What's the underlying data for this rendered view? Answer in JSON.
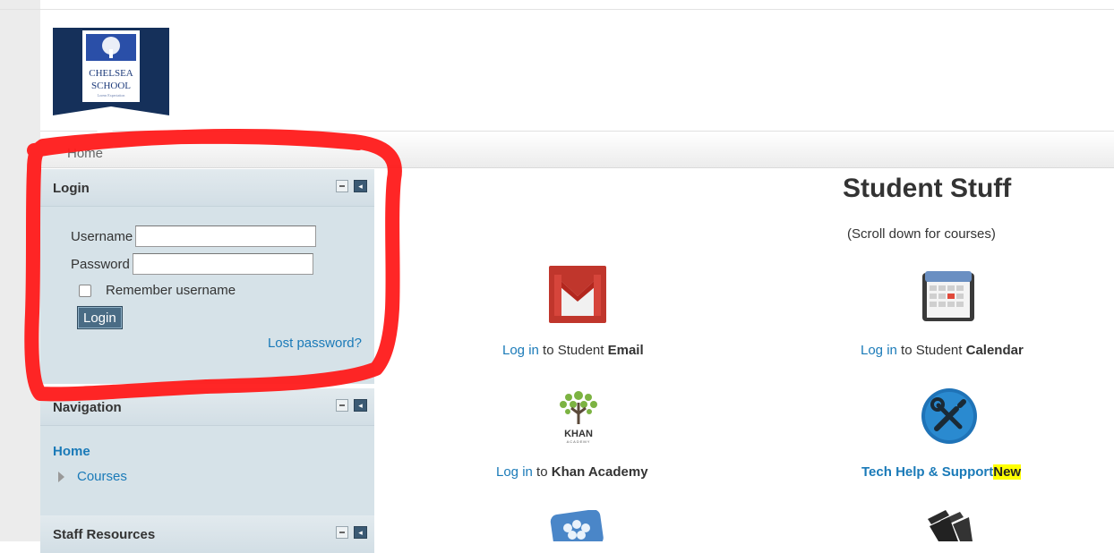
{
  "logo": {
    "line1": "CHELSEA",
    "line2": "SCHOOL",
    "tagline": "Lorem Expectation"
  },
  "breadcrumb": {
    "home": "Home"
  },
  "login_block": {
    "title": "Login",
    "username_label": "Username",
    "username_value": "",
    "password_label": "Password",
    "password_value": "",
    "remember_label": "Remember username",
    "login_button": "Login",
    "lost_password": "Lost password?"
  },
  "navigation_block": {
    "title": "Navigation",
    "home": "Home",
    "courses": "Courses"
  },
  "staff_block": {
    "title": "Staff Resources"
  },
  "main": {
    "title": "Student Stuff",
    "subnote": "(Scroll down for courses)",
    "tiles": {
      "email": {
        "link": "Log in",
        "mid": " to Student ",
        "bold": "Email",
        "icon": "gmail-icon"
      },
      "calendar": {
        "link": "Log in",
        "mid": " to Student ",
        "bold": "Calendar",
        "icon": "calendar-icon"
      },
      "khan": {
        "link": "Log in",
        "mid": " to ",
        "bold": "Khan Academy",
        "icon": "khan-academy-icon",
        "logo_text": "KHAN",
        "logo_sub": "ACADEMY"
      },
      "tech": {
        "link": "Tech Help & Support",
        "badge": "New",
        "icon": "tools-icon"
      }
    }
  },
  "colors": {
    "accent_link": "#1a7ab8",
    "annotation": "#ff1a1a",
    "block_bg": "#d6e2e8"
  }
}
